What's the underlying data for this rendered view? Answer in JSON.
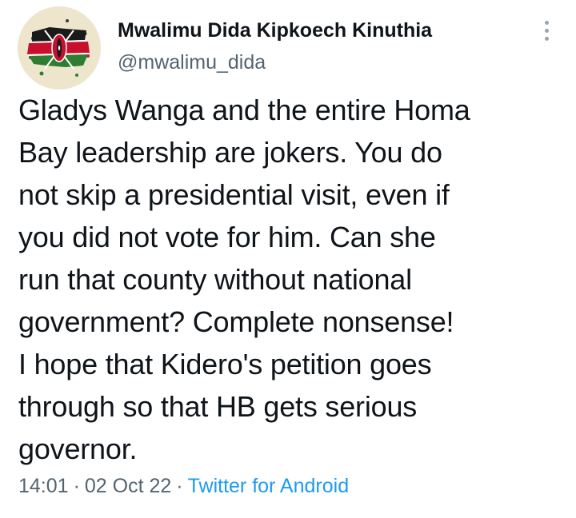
{
  "author": {
    "display_name": "Mwalimu Dida Kipkoech Kinuthia",
    "handle": "@mwalimu_dida",
    "avatar_icon": "kenya-flag-shield-avatar-icon"
  },
  "menu": {
    "icon": "more-vertical-icon"
  },
  "tweet": {
    "lines": [
      "Gladys Wanga and the entire Homa",
      "Bay leadership are jokers. You do",
      "not skip a presidential visit, even if",
      "you did not vote for him. Can she",
      "run that county without national",
      "government? Complete nonsense!",
      "I hope that Kidero's petition goes",
      "through so that HB gets serious",
      "governor."
    ]
  },
  "meta": {
    "time": "14:01",
    "separator": "·",
    "date": "02 Oct 22",
    "source": "Twitter for Android"
  },
  "colors": {
    "text": "#0f1419",
    "secondary": "#536471",
    "link": "#1d9bf0",
    "flag_red": "#c8102e",
    "flag_green": "#2e7d32"
  }
}
